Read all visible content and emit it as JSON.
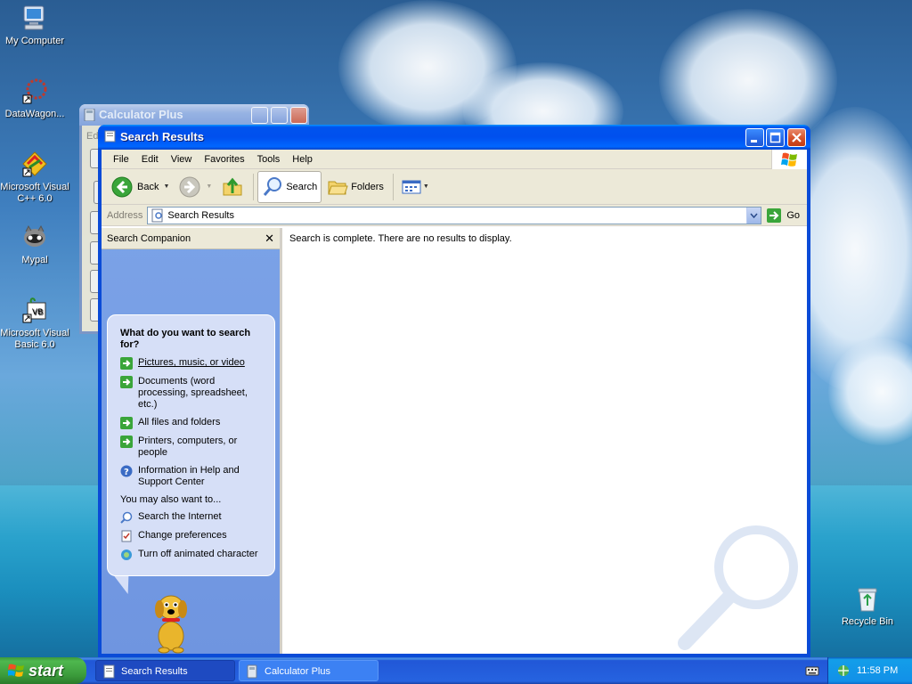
{
  "desktop": {
    "icons": [
      {
        "label": "My Computer"
      },
      {
        "label": "DataWagon..."
      },
      {
        "label": "Microsoft Visual C++ 6.0"
      },
      {
        "label": "Mypal"
      },
      {
        "label": "Microsoft Visual Basic 6.0"
      },
      {
        "label": "Recycle Bin"
      }
    ]
  },
  "background_window": {
    "title": "Calculator Plus",
    "menu_fragment": "Edi"
  },
  "window": {
    "title": "Search Results",
    "menu": [
      "File",
      "Edit",
      "View",
      "Favorites",
      "Tools",
      "Help"
    ],
    "toolbar": {
      "back_label": "Back",
      "search_label": "Search",
      "folders_label": "Folders"
    },
    "address": {
      "label": "Address",
      "value": "Search Results",
      "go_label": "Go"
    },
    "sidebar": {
      "title": "Search Companion",
      "question": "What do you want to search for?",
      "options": [
        {
          "label": "Pictures, music, or video",
          "icon": "green-arrow-icon"
        },
        {
          "label": "Documents (word processing, spreadsheet, etc.)",
          "icon": "green-arrow-icon"
        },
        {
          "label": "All files and folders",
          "icon": "green-arrow-icon"
        },
        {
          "label": "Printers, computers, or people",
          "icon": "green-arrow-icon"
        },
        {
          "label": "Information in Help and Support Center",
          "icon": "help-icon"
        }
      ],
      "also_label": "You may also want to...",
      "also_options": [
        {
          "label": "Search the Internet",
          "icon": "search-internet-icon"
        },
        {
          "label": "Change preferences",
          "icon": "preferences-icon"
        },
        {
          "label": "Turn off animated character",
          "icon": "character-icon"
        }
      ]
    },
    "main_message": "Search is complete. There are no results to display."
  },
  "taskbar": {
    "start_label": "start",
    "tasks": [
      {
        "label": "Search Results",
        "active": true
      },
      {
        "label": "Calculator Plus",
        "active": false
      }
    ],
    "clock": "11:58 PM"
  },
  "colors": {
    "titlebar": "#0053ee",
    "sidebar": "#7ba2e7",
    "start_button": "#3a993a",
    "taskbar": "#2663e0"
  }
}
